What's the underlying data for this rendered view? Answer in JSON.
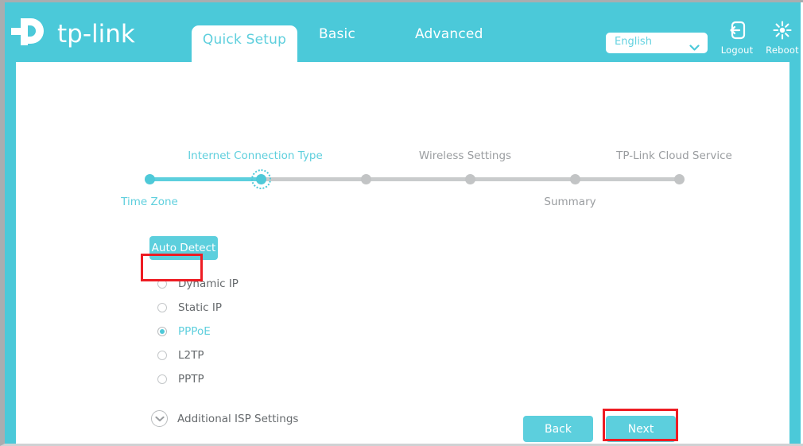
{
  "header": {
    "brand": "tp-link",
    "brand_icon": "tp-link-logo-icon",
    "tabs": [
      {
        "label": "Quick Setup",
        "active": true
      },
      {
        "label": "Basic",
        "active": false
      },
      {
        "label": "Advanced",
        "active": false
      }
    ],
    "language": {
      "value": "English",
      "chevron_icon": "chevron-down-icon"
    },
    "logout": {
      "label": "Logout",
      "icon": "logout-icon"
    },
    "reboot": {
      "label": "Reboot",
      "icon": "reboot-icon"
    },
    "background_color": "#4bc9d9"
  },
  "stepper": {
    "steps": [
      {
        "label": "Time Zone",
        "position": "below",
        "state": "done"
      },
      {
        "label": "Internet Connection Type",
        "position": "above",
        "state": "current"
      },
      {
        "label": "Wireless Settings",
        "position": "above",
        "state": "pending"
      },
      {
        "label": "",
        "position": "none",
        "state": "pending"
      },
      {
        "label": "Summary",
        "position": "below",
        "state": "pending"
      },
      {
        "label": "TP-Link Cloud Service",
        "position": "above",
        "state": "pending"
      }
    ],
    "active_color": "#5ecfdd",
    "inactive_color": "#c2c4c5"
  },
  "form": {
    "auto_detect_label": "Auto Detect",
    "connection_types": [
      {
        "label": "Dynamic IP",
        "selected": false
      },
      {
        "label": "Static IP",
        "selected": false
      },
      {
        "label": "PPPoE",
        "selected": true
      },
      {
        "label": "L2TP",
        "selected": false
      },
      {
        "label": "PPTP",
        "selected": false
      }
    ],
    "additional_isp": {
      "label": "Additional ISP Settings",
      "icon": "chevron-down-circle-icon",
      "expanded": false
    }
  },
  "footer": {
    "back_label": "Back",
    "next_label": "Next"
  },
  "annotations": {
    "color": "#ee1c23",
    "boxes": [
      {
        "target": "PPPoE"
      },
      {
        "target": "Next"
      }
    ]
  }
}
